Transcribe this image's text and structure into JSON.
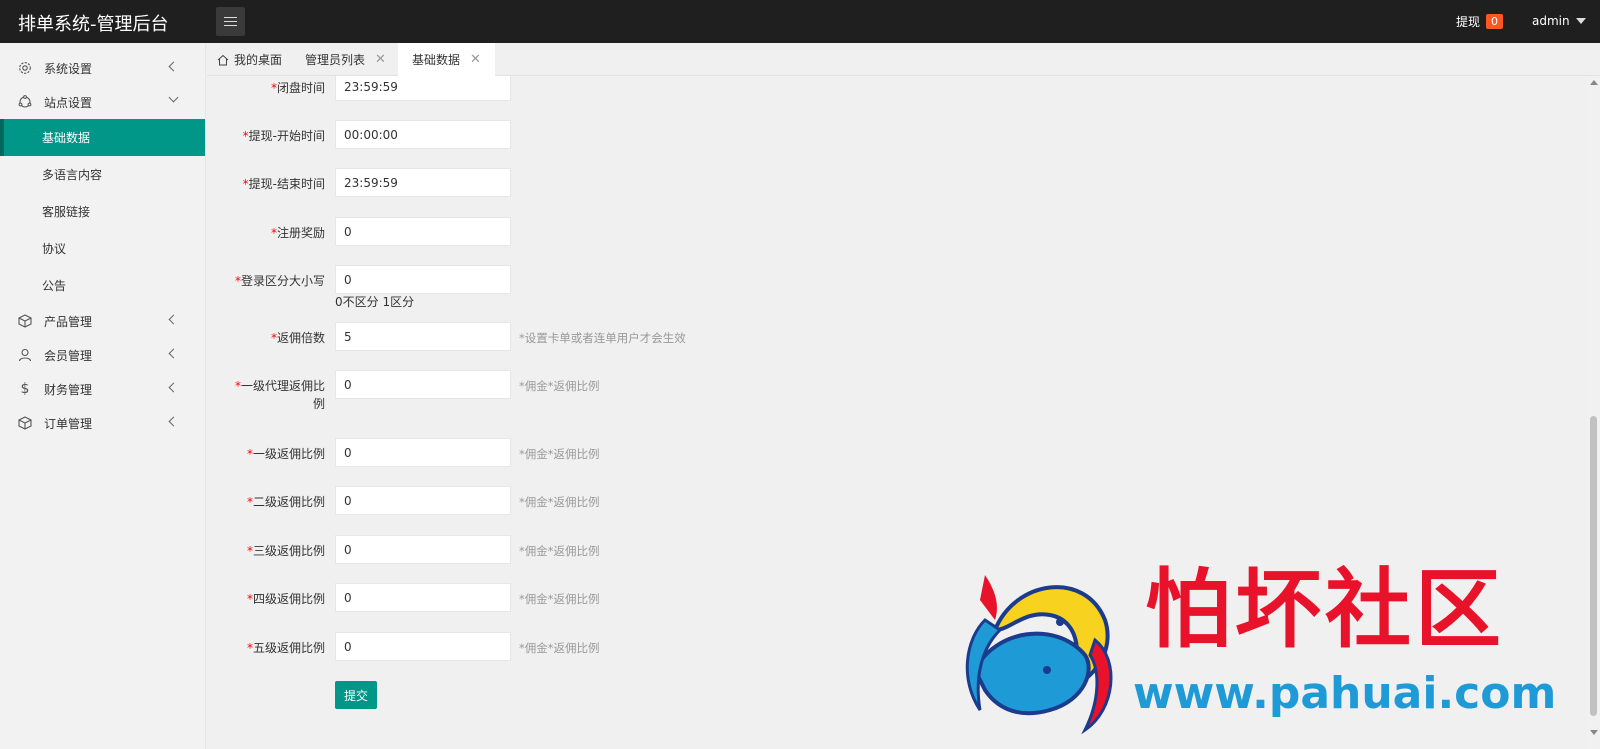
{
  "header": {
    "title": "排单系统-管理后台",
    "withdraw_label": "提现",
    "withdraw_count": "0",
    "user": "admin"
  },
  "sidebar": {
    "groups": [
      {
        "label": "系统设置",
        "icon": "gear-icon"
      },
      {
        "label": "站点设置",
        "icon": "site-icon"
      },
      {
        "label": "产品管理",
        "icon": "cube-icon"
      },
      {
        "label": "会员管理",
        "icon": "user-icon"
      },
      {
        "label": "财务管理",
        "icon": "dollar-icon"
      },
      {
        "label": "订单管理",
        "icon": "order-cube-icon"
      }
    ],
    "site_items": [
      "基础数据",
      "多语言内容",
      "客服链接",
      "协议",
      "公告"
    ]
  },
  "tabs": [
    {
      "label": "我的桌面",
      "icon": "home-icon"
    },
    {
      "label": "管理员列表"
    },
    {
      "label": "基础数据"
    }
  ],
  "form": {
    "fields": [
      {
        "label": "闭盘时间",
        "value": "23:59:59",
        "hint": ""
      },
      {
        "label": "提现-开始时间",
        "value": "00:00:00",
        "hint": ""
      },
      {
        "label": "提现-结束时间",
        "value": "23:59:59",
        "hint": ""
      },
      {
        "label": "注册奖励",
        "value": "0",
        "hint": ""
      },
      {
        "label": "登录区分大小写",
        "value": "0",
        "hint": "",
        "note": "0不区分 1区分"
      },
      {
        "label": "返佣倍数",
        "value": "5",
        "hint": "*设置卡单或者连单用户才会生效"
      },
      {
        "label": "一级代理返佣比",
        "label2": "例",
        "value": "0",
        "hint": "*佣金*返佣比例"
      },
      {
        "label": "一级返佣比例",
        "value": "0",
        "hint": "*佣金*返佣比例"
      },
      {
        "label": "二级返佣比例",
        "value": "0",
        "hint": "*佣金*返佣比例"
      },
      {
        "label": "三级返佣比例",
        "value": "0",
        "hint": "*佣金*返佣比例"
      },
      {
        "label": "四级返佣比例",
        "value": "0",
        "hint": "*佣金*返佣比例"
      },
      {
        "label": "五级返佣比例",
        "value": "0",
        "hint": "*佣金*返佣比例"
      }
    ],
    "required_mark": "*",
    "submit_label": "提交"
  },
  "watermark": {
    "title": "怕坏社区",
    "url": "www.pahuai.com"
  },
  "colors": {
    "header_bg": "#1f1f1f",
    "accent": "#009688",
    "badge": "#ff5722",
    "required": "#ff0000",
    "watermark_red": "#e8132a",
    "watermark_blue": "#1e9ad6"
  }
}
